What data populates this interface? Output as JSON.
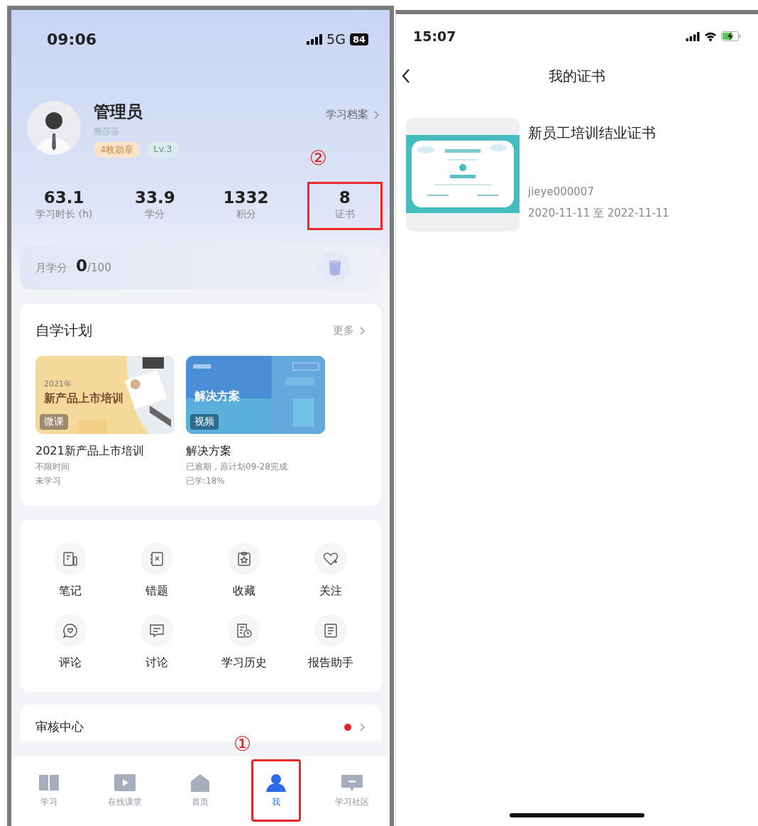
{
  "left_phone": {
    "status_bar": {
      "time": "09:06",
      "network": "5G",
      "battery": "84"
    },
    "profile": {
      "name": "管理员",
      "subtitle": "熊莎莎",
      "badges": [
        {
          "label": "4枚勋章",
          "kind": "medal"
        },
        {
          "label": "Lv.3",
          "kind": "level"
        }
      ],
      "archive_link": "学习档案"
    },
    "stats": [
      {
        "value": "63.1",
        "label": "学习时长 (h)",
        "highlighted": false
      },
      {
        "value": "33.9",
        "label": "学分",
        "highlighted": false
      },
      {
        "value": "1332",
        "label": "积分",
        "highlighted": false
      },
      {
        "value": "8",
        "label": "证书",
        "highlighted": true,
        "callout": "②"
      }
    ],
    "monthly_credit": {
      "label": "月学分",
      "value": "0",
      "total": "/100"
    },
    "plan": {
      "title": "自学计划",
      "more": "更多",
      "courses": [
        {
          "kind": "warm",
          "cover_year": "2021年",
          "cover_title": "新产品上市培训",
          "tag": "微课",
          "title": "2021新产品上市培训",
          "lines": [
            "不限时间",
            "未学习"
          ]
        },
        {
          "kind": "blue",
          "cover_title": "解决方案",
          "tag": "视频",
          "title": "解决方案",
          "lines": [
            "已逾期，原计划09-28完成",
            "已学:18%"
          ]
        }
      ]
    },
    "shortcuts": [
      {
        "label": "笔记",
        "kind": "note"
      },
      {
        "label": "错题",
        "kind": "wrong"
      },
      {
        "label": "收藏",
        "kind": "favorite"
      },
      {
        "label": "关注",
        "kind": "follow"
      },
      {
        "label": "评论",
        "kind": "comment"
      },
      {
        "label": "讨论",
        "kind": "discussion"
      },
      {
        "label": "学习历史",
        "kind": "history"
      },
      {
        "label": "报告助手",
        "kind": "report"
      }
    ],
    "review": {
      "title": "审核中心",
      "unread": true
    },
    "tabs": [
      {
        "label": "学习",
        "kind": "book",
        "selected": false,
        "highlighted": false
      },
      {
        "label": "在线课堂",
        "kind": "play",
        "selected": false,
        "highlighted": false
      },
      {
        "label": "首页",
        "kind": "home",
        "selected": false,
        "highlighted": false
      },
      {
        "label": "我",
        "kind": "person",
        "selected": true,
        "highlighted": true,
        "callout": "①"
      },
      {
        "label": "学习社区",
        "kind": "chat",
        "selected": false,
        "highlighted": false
      }
    ]
  },
  "right_phone": {
    "status_bar": {
      "time": "15:07",
      "charging": true
    },
    "nav": {
      "title": "我的证书"
    },
    "certificates": [
      {
        "title": "新员工培训结业证书",
        "code": "jieye000007",
        "validity": "2020-11-11 至 2022-11-11"
      }
    ]
  }
}
